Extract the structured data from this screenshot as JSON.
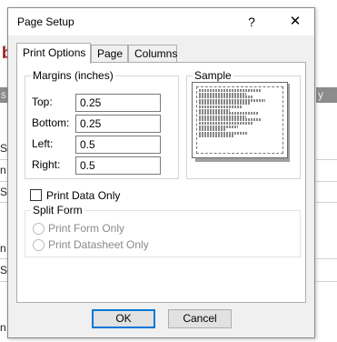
{
  "dialog": {
    "title": "Page Setup",
    "help_glyph": "?",
    "close_glyph": "✕"
  },
  "tabs": [
    {
      "label": "Print Options",
      "active": true
    },
    {
      "label": "Page",
      "active": false
    },
    {
      "label": "Columns",
      "active": false
    }
  ],
  "margins": {
    "title": "Margins (inches)",
    "top_label": "Top:",
    "top_value": "0.25",
    "bottom_label": "Bottom:",
    "bottom_value": "0.25",
    "left_label": "Left:",
    "left_value": "0.5",
    "right_label": "Right:",
    "right_value": "0.5"
  },
  "sample": {
    "title": "Sample"
  },
  "print_data_only": {
    "label": "Print Data Only",
    "checked": false
  },
  "split_form": {
    "title": "Split Form",
    "options": [
      {
        "label": "Print Form Only"
      },
      {
        "label": "Print Datasheet Only"
      }
    ]
  },
  "buttons": {
    "ok": "OK",
    "cancel": "Cancel"
  },
  "background": {
    "left_header": "s",
    "right_header": "y Pro",
    "left_cells": [
      "St",
      "n S",
      "St",
      "n S",
      "St",
      "n S"
    ]
  },
  "colors": {
    "accent": "#0078d7",
    "brand": "#9b1b1b"
  }
}
